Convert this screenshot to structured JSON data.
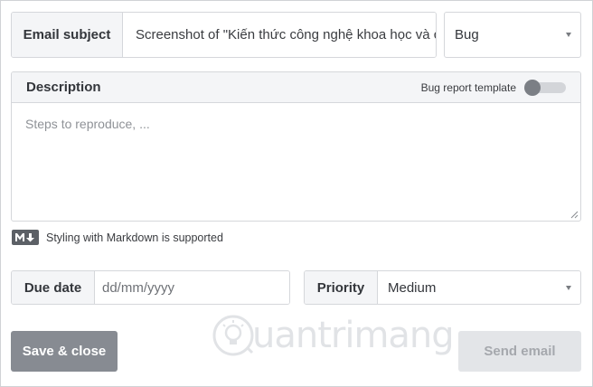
{
  "subject": {
    "label": "Email subject",
    "value": "Screenshot of \"Kiến thức công nghệ khoa học và cu"
  },
  "type_select": {
    "value": "Bug"
  },
  "description": {
    "title": "Description",
    "template_label": "Bug report template",
    "template_toggle_on": false,
    "placeholder": "Steps to reproduce, ..."
  },
  "markdown_note": {
    "text": "Styling with Markdown is supported"
  },
  "due_date": {
    "label": "Due date",
    "placeholder": "dd/mm/yyyy"
  },
  "priority": {
    "label": "Priority",
    "value": "Medium"
  },
  "buttons": {
    "save_close": "Save & close",
    "send_email": "Send email"
  },
  "watermark": {
    "text": "uantrimang"
  }
}
